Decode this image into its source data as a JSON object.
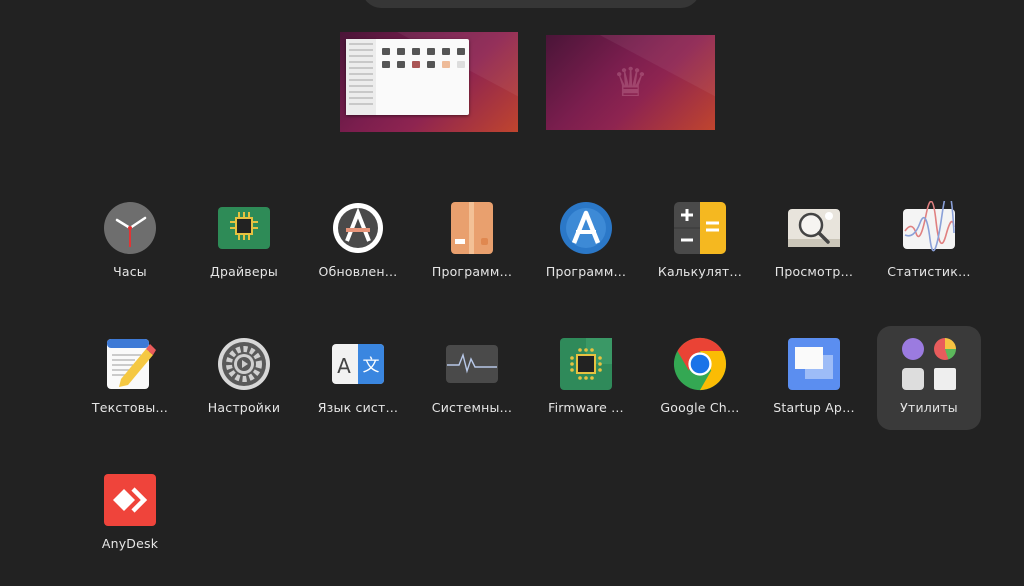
{
  "workspaces": [
    {
      "name": "workspace-1",
      "has_window": true
    },
    {
      "name": "workspace-2",
      "has_window": false
    }
  ],
  "apps": [
    {
      "label": "Часы",
      "icon": "clock-icon"
    },
    {
      "label": "Драйверы",
      "icon": "chip-icon"
    },
    {
      "label": "Обновлен…",
      "icon": "software-updater-icon"
    },
    {
      "label": "Программ…",
      "icon": "package-box-icon"
    },
    {
      "label": "Программ…",
      "icon": "app-center-icon"
    },
    {
      "label": "Калькулят…",
      "icon": "calculator-icon"
    },
    {
      "label": "Просмотр…",
      "icon": "image-viewer-icon"
    },
    {
      "label": "Статистик…",
      "icon": "statistics-chart-icon"
    },
    {
      "label": "Текстовы…",
      "icon": "text-editor-icon"
    },
    {
      "label": "Настройки",
      "icon": "settings-gear-icon"
    },
    {
      "label": "Язык сист…",
      "icon": "language-icon"
    },
    {
      "label": "Системны…",
      "icon": "system-monitor-icon"
    },
    {
      "label": "Firmware …",
      "icon": "firmware-chip-icon"
    },
    {
      "label": "Google Ch…",
      "icon": "chrome-icon"
    },
    {
      "label": "Startup Ap…",
      "icon": "startup-apps-icon"
    },
    {
      "label": "Утилиты",
      "icon": "utilities-folder-icon"
    },
    {
      "label": "AnyDesk",
      "icon": "anydesk-icon"
    }
  ],
  "colors": {
    "background": "#222222",
    "folder_bg": "#3a3a3a",
    "anydesk": "#ef443b",
    "chrome_blue": "#1a73e8"
  }
}
